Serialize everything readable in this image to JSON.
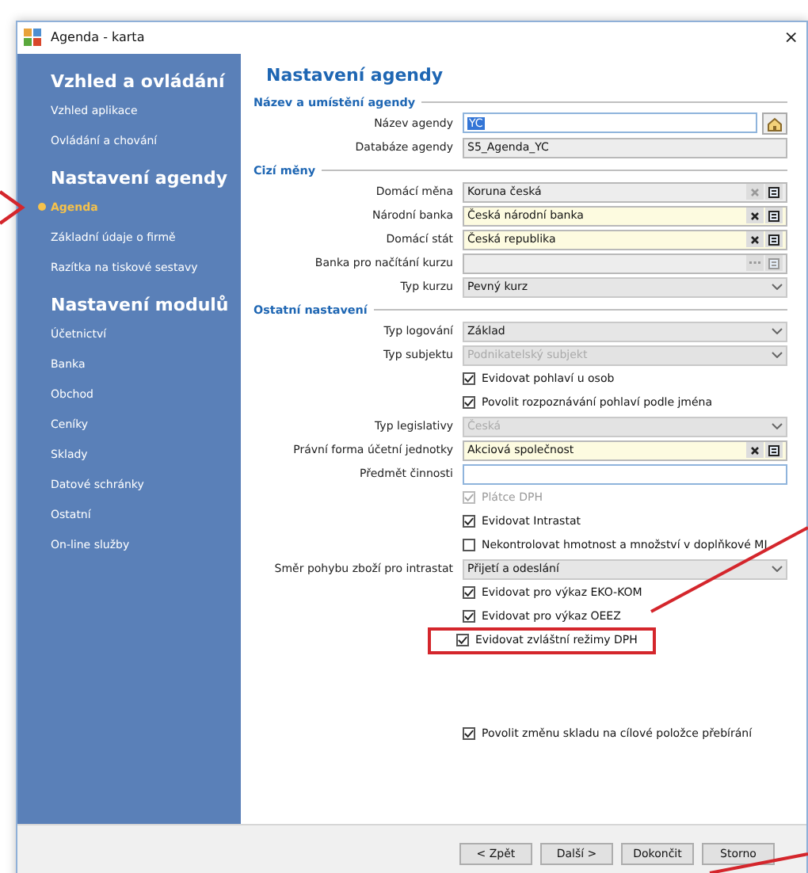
{
  "window": {
    "title": "Agenda - karta",
    "close": "×"
  },
  "sidebar": [
    {
      "title": "Vzhled a ovládání",
      "items": [
        {
          "label": "Vzhled aplikace",
          "selected": false
        },
        {
          "label": "Ovládání a chování",
          "selected": false
        }
      ]
    },
    {
      "title": "Nastavení agendy",
      "items": [
        {
          "label": "Agenda",
          "selected": true
        },
        {
          "label": "Základní údaje o firmě",
          "selected": false
        },
        {
          "label": "Razítka na tiskové sestavy",
          "selected": false
        }
      ]
    },
    {
      "title": "Nastavení modulů",
      "items": [
        {
          "label": "Účetnictví",
          "selected": false
        },
        {
          "label": "Banka",
          "selected": false
        },
        {
          "label": "Obchod",
          "selected": false
        },
        {
          "label": "Ceníky",
          "selected": false
        },
        {
          "label": "Sklady",
          "selected": false
        },
        {
          "label": "Datové schránky",
          "selected": false
        },
        {
          "label": "Ostatní",
          "selected": false
        },
        {
          "label": "On-line služby",
          "selected": false
        }
      ]
    }
  ],
  "page_title": "Nastavení agendy",
  "sections": [
    {
      "title": "Název a umístění agendy",
      "rows": [
        {
          "kind": "field",
          "label": "Název agendy",
          "value": "YC",
          "required": false,
          "read_only": false,
          "text_selected": true,
          "home_button": true,
          "buttons": []
        },
        {
          "kind": "field",
          "label": "Databáze agendy",
          "value": "S5_Agenda_YC",
          "required": false,
          "read_only": true,
          "text_selected": false,
          "home_button": false,
          "buttons": []
        }
      ]
    },
    {
      "title": "Cizí měny",
      "rows": [
        {
          "kind": "field",
          "label": "Domácí měna",
          "value": "Koruna česká",
          "required": false,
          "read_only": true,
          "text_selected": false,
          "home_button": false,
          "buttons": [
            {
              "kind": "clear",
              "disabled": true
            },
            {
              "kind": "list",
              "disabled": false
            }
          ]
        },
        {
          "kind": "field",
          "label": "Národní banka",
          "value": "Česká národní banka",
          "required": true,
          "read_only": false,
          "text_selected": false,
          "home_button": false,
          "buttons": [
            {
              "kind": "clear",
              "disabled": false
            },
            {
              "kind": "list",
              "disabled": false
            }
          ]
        },
        {
          "kind": "field",
          "label": "Domácí stát",
          "value": "Česká republika",
          "required": true,
          "read_only": false,
          "text_selected": false,
          "home_button": false,
          "buttons": [
            {
              "kind": "clear",
              "disabled": false
            },
            {
              "kind": "list",
              "disabled": false
            }
          ]
        },
        {
          "kind": "field",
          "label": "Banka pro načítání kurzu",
          "required": false,
          "read_only": true,
          "text_selected": false,
          "home_button": false,
          "buttons": [
            {
              "kind": "more",
              "disabled": true
            },
            {
              "kind": "list",
              "disabled": true
            }
          ]
        },
        {
          "kind": "select",
          "label": "Typ kurzu",
          "value": "Pevný kurz",
          "disabled": false
        }
      ]
    },
    {
      "title": "Ostatní nastavení",
      "rows": [
        {
          "kind": "select",
          "label": "Typ logování",
          "value": "Základ",
          "disabled": false
        },
        {
          "kind": "select",
          "label": "Typ subjektu",
          "value": "Podnikatelský subjekt",
          "disabled": true
        },
        {
          "kind": "checkbox",
          "label": "Evidovat pohlaví u osob",
          "checked": true,
          "disabled": false,
          "highlighted": false
        },
        {
          "kind": "checkbox",
          "label": "Povolit rozpoznávání pohlaví podle jména",
          "checked": true,
          "disabled": false,
          "highlighted": false
        },
        {
          "kind": "select",
          "label": "Typ legislativy",
          "value": "Česká",
          "disabled": true
        },
        {
          "kind": "field",
          "label": "Právní forma účetní jednotky",
          "value": "Akciová společnost",
          "required": true,
          "read_only": false,
          "text_selected": false,
          "home_button": false,
          "buttons": [
            {
              "kind": "clear",
              "disabled": false
            },
            {
              "kind": "list",
              "disabled": false
            }
          ]
        },
        {
          "kind": "field",
          "label": "Předmět činnosti",
          "required": false,
          "read_only": false,
          "text_selected": false,
          "home_button": false,
          "buttons": []
        },
        {
          "kind": "checkbox",
          "label": "Plátce DPH",
          "checked": true,
          "disabled": true,
          "highlighted": false
        },
        {
          "kind": "checkbox",
          "label": "Evidovat Intrastat",
          "checked": true,
          "disabled": false,
          "highlighted": false
        },
        {
          "kind": "checkbox",
          "label": "Nekontrolovat hmotnost a množství v doplňkové MJ",
          "checked": false,
          "disabled": false,
          "highlighted": false
        },
        {
          "kind": "select",
          "label": "Směr pohybu zboží pro intrastat",
          "value": "Přijetí a odeslání",
          "disabled": false
        },
        {
          "kind": "checkbox",
          "label": "Evidovat pro výkaz EKO-KOM",
          "checked": true,
          "disabled": false,
          "highlighted": false
        },
        {
          "kind": "checkbox",
          "label": "Evidovat pro výkaz OEEZ",
          "checked": true,
          "disabled": false,
          "highlighted": false
        },
        {
          "kind": "checkbox",
          "label": "Evidovat zvláštní režimy DPH",
          "checked": true,
          "disabled": false,
          "highlighted": true
        }
      ]
    }
  ],
  "bottom_option": {
    "label": "Povolit změnu skladu na cílové položce přebírání",
    "checked": true
  },
  "buttons": [
    {
      "label": "< Zpět"
    },
    {
      "label": "Další >"
    },
    {
      "label": "Dokončit"
    },
    {
      "label": "Storno"
    }
  ]
}
